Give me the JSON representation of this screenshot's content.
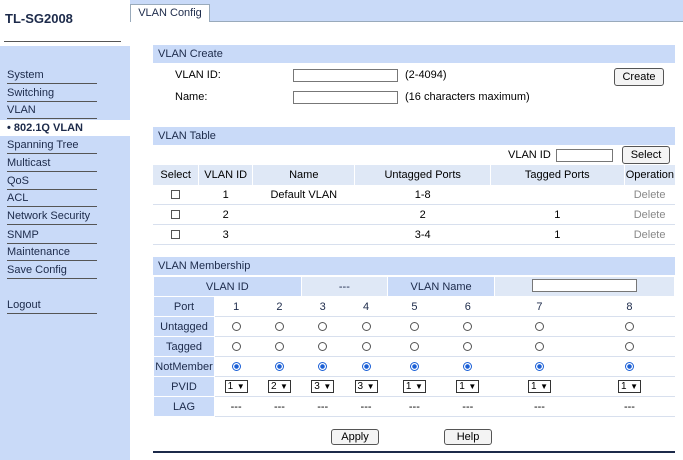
{
  "brand": "TL-SG2008",
  "sidebar": [
    {
      "label": "System",
      "active": false
    },
    {
      "label": "Switching",
      "active": false
    },
    {
      "label": "VLAN",
      "active": false
    },
    {
      "label": "• 802.1Q VLAN",
      "active": true
    },
    {
      "label": "Spanning Tree",
      "active": false
    },
    {
      "label": "Multicast",
      "active": false
    },
    {
      "label": "QoS",
      "active": false
    },
    {
      "label": "ACL",
      "active": false
    },
    {
      "label": "Network Security",
      "active": false
    },
    {
      "label": "SNMP",
      "active": false
    },
    {
      "label": "Maintenance",
      "active": false
    },
    {
      "label": "Save Config",
      "active": false
    },
    {
      "label": "Logout",
      "active": false
    }
  ],
  "tab": "VLAN Config",
  "create": {
    "title": "VLAN Create",
    "vlan_id_label": "VLAN ID:",
    "vlan_id_value": "",
    "vlan_id_hint": "(2-4094)",
    "name_label": "Name:",
    "name_value": "",
    "name_hint": "(16 characters maximum)",
    "create_button": "Create"
  },
  "table": {
    "title": "VLAN Table",
    "search_label": "VLAN ID",
    "search_value": "",
    "select_button": "Select",
    "columns": [
      "Select",
      "VLAN ID",
      "Name",
      "Untagged Ports",
      "Tagged Ports",
      "Operation"
    ],
    "rows": [
      {
        "id": "1",
        "name": "Default VLAN",
        "untagged": "1-8",
        "tagged": "",
        "op": "Delete"
      },
      {
        "id": "2",
        "name": "",
        "untagged": "2",
        "tagged": "1",
        "op": "Delete"
      },
      {
        "id": "3",
        "name": "",
        "untagged": "3-4",
        "tagged": "1",
        "op": "Delete"
      }
    ]
  },
  "membership": {
    "title": "VLAN Membership",
    "vlan_id_label": "VLAN ID",
    "vlan_id_value": "---",
    "vlan_name_label": "VLAN Name",
    "vlan_name_value": "",
    "port_label": "Port",
    "ports": [
      "1",
      "2",
      "3",
      "4",
      "5",
      "6",
      "7",
      "8"
    ],
    "untagged_label": "Untagged",
    "tagged_label": "Tagged",
    "notmember_label": "NotMember",
    "selection": [
      "notmember",
      "notmember",
      "notmember",
      "notmember",
      "notmember",
      "notmember",
      "notmember",
      "notmember"
    ],
    "pvid_label": "PVID",
    "pvid": [
      "1",
      "2",
      "3",
      "3",
      "1",
      "1",
      "1",
      "1"
    ],
    "lag_label": "LAG",
    "lag": [
      "---",
      "---",
      "---",
      "---",
      "---",
      "---",
      "---",
      "---"
    ]
  },
  "buttons": {
    "apply": "Apply",
    "help": "Help"
  }
}
